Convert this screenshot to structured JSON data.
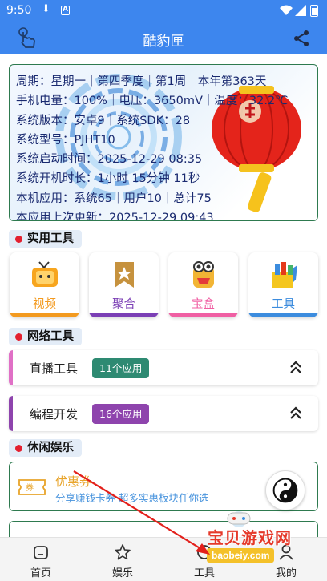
{
  "status_bar": {
    "time": "9:50"
  },
  "app": {
    "title": "酷豹匣"
  },
  "info": {
    "lines": [
      "周期：星期一｜第四季度｜第1周｜本年第363天",
      "手机电量：100%｜电压：3650mV｜温度：32.2℃",
      "系统版本：安卓9｜系统SDK：28",
      "系统型号：PJHT10",
      "系统启动时间：2025-12-29 08:35",
      "系统开机时长：1小时 15分钟 11秒",
      "本机应用：系统65｜用户10｜总计75",
      "本应用上次更新：2025-12-29 09:43"
    ]
  },
  "sections": {
    "practical": "实用工具",
    "network": "网络工具",
    "leisure": "休闲娱乐"
  },
  "tools": [
    {
      "label": "视频",
      "color": "#f39a1f"
    },
    {
      "label": "聚合",
      "color": "#7b3fb5"
    },
    {
      "label": "宝盒",
      "color": "#f05fa3"
    },
    {
      "label": "工具",
      "color": "#3c8cde"
    }
  ],
  "network_rows": [
    {
      "name": "直播工具",
      "badge": "11个应用",
      "stripe": "#e070c6",
      "badge_color": "#2e8a72"
    },
    {
      "name": "编程开发",
      "badge": "16个应用",
      "stripe": "#8e44ad",
      "badge_color": "#8e44ad"
    }
  ],
  "coupon": {
    "title": "优惠券",
    "subtitle": "分享赚钱卡券 超多实惠板块任你选"
  },
  "nav": [
    {
      "label": "首页"
    },
    {
      "label": "娱乐"
    },
    {
      "label": "工具"
    },
    {
      "label": "我的"
    }
  ],
  "watermark": {
    "text": "宝贝游戏网",
    "url": "baobeiy.com"
  }
}
